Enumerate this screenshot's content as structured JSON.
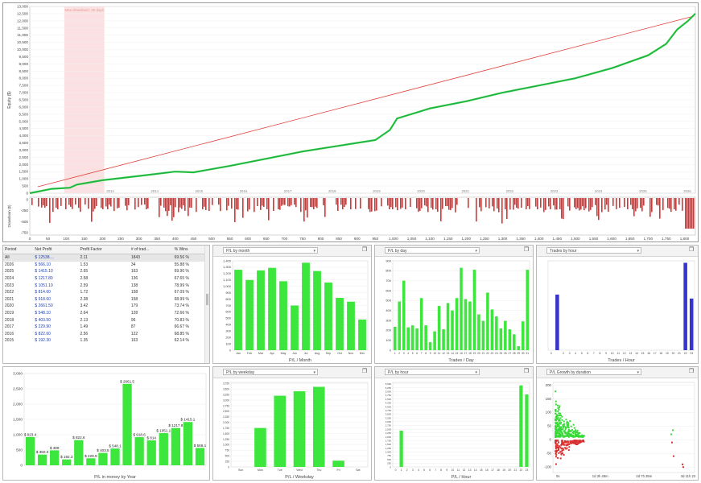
{
  "equity_chart": {
    "y_ticks": [
      "0",
      "500",
      "1,000",
      "1,500",
      "2,000",
      "2,500",
      "3,000",
      "3,500",
      "4,000",
      "4,500",
      "5,000",
      "5,500",
      "6,000",
      "6,500",
      "7,000",
      "7,500",
      "8,000",
      "8,500",
      "9,000",
      "9,500",
      "10,000",
      "10,500",
      "11,000",
      "11,500",
      "12,000",
      "12,500",
      "13,000"
    ],
    "y_label": "Equity ($)",
    "dd_ticks": [
      "0",
      "-250",
      "-500",
      "-750"
    ],
    "dd_label": "Drawdown ($)",
    "x_ticks": [
      "0",
      "50",
      "100",
      "150",
      "200",
      "250",
      "300",
      "350",
      "400",
      "450",
      "500",
      "550",
      "600",
      "650",
      "700",
      "750",
      "800",
      "850",
      "900",
      "950",
      "1,000",
      "1,050",
      "1,100",
      "1,150",
      "1,200",
      "1,250",
      "1,300",
      "1,350",
      "1,400",
      "1,450",
      "1,500",
      "1,550",
      "1,600",
      "1,650",
      "1,700",
      "1,750",
      "1,800"
    ],
    "year_labels": [
      "2013",
      "2014",
      "2015",
      "2016",
      "2017",
      "2018",
      "2019",
      "2020",
      "2021",
      "2022",
      "2023",
      "2024",
      "2025",
      "2026"
    ],
    "highlight_label": "Max drawdown: 30 days",
    "colors": {
      "equity": "#22cc33",
      "trend": "#e0413a",
      "drawdown": "#e03030",
      "highlight": "#fbdede"
    }
  },
  "stats_table": {
    "headers": [
      "Period",
      "Net Profit",
      "Profit Factor",
      "# of trad...",
      "% Wins"
    ],
    "rows": [
      [
        "All",
        "$ 12538....",
        "2.11",
        "1843",
        "69.56 %"
      ],
      [
        "2026",
        "$ 566.10",
        "1.53",
        "34",
        "55.88 %"
      ],
      [
        "2025",
        "$ 1415.10",
        "2.65",
        "163",
        "69.90 %"
      ],
      [
        "2024",
        "$ 1217.80",
        "2.58",
        "136",
        "67.65 %"
      ],
      [
        "2023",
        "$ 1051.10",
        "2.59",
        "138",
        "78.99 %"
      ],
      [
        "2022",
        "$ 814.60",
        "1.72",
        "158",
        "67.09 %"
      ],
      [
        "2021",
        "$ 918.60",
        "2.38",
        "158",
        "68.99 %"
      ],
      [
        "2020",
        "$ 2661.50",
        "3.42",
        "179",
        "73.74 %"
      ],
      [
        "2019",
        "$ 548.10",
        "2.64",
        "128",
        "72.66 %"
      ],
      [
        "2018",
        "$ 403.50",
        "2.13",
        "96",
        "70.83 %"
      ],
      [
        "2017",
        "$ 229.90",
        "1.49",
        "87",
        "66.67 %"
      ],
      [
        "2016",
        "$ 822.60",
        "2.56",
        "122",
        "68.85 %"
      ],
      [
        "2015",
        "$ 192.30",
        "1.35",
        "163",
        "62.14 %"
      ]
    ]
  },
  "panels": {
    "month": {
      "select": "P/L by month"
    },
    "day": {
      "select": "P/L by day"
    },
    "trades_hour": {
      "select": "Trades by hour"
    },
    "weekday": {
      "select": "P/L by weekday"
    },
    "hour": {
      "select": "P/L by hour"
    },
    "duration": {
      "select": "P/L Growth by duration"
    }
  },
  "chart_data": [
    {
      "type": "bar",
      "id": "pl_month",
      "xlabel": "P/L / Month",
      "categories": [
        "Jan",
        "Feb",
        "Mar",
        "Apr",
        "May",
        "Jun",
        "Jul",
        "Aug",
        "Sep",
        "Oct",
        "Nov",
        "Dec"
      ],
      "values": [
        1260,
        1100,
        1250,
        1290,
        1080,
        700,
        1370,
        1240,
        1060,
        820,
        760,
        480
      ],
      "ylim": [
        0,
        1400
      ],
      "y_ticks": [
        "0",
        "100",
        "200",
        "300",
        "400",
        "500",
        "600",
        "700",
        "800",
        "900",
        "1,000",
        "1,100",
        "1,200",
        "1,300",
        "1,400"
      ],
      "color": "#3ce63c"
    },
    {
      "type": "bar",
      "id": "pl_day",
      "xlabel": "Trades / Day",
      "categories": [
        "1",
        "2",
        "3",
        "4",
        "5",
        "6",
        "7",
        "8",
        "9",
        "10",
        "11",
        "12",
        "13",
        "14",
        "15",
        "16",
        "17",
        "18",
        "19",
        "20",
        "21",
        "22",
        "23",
        "24",
        "25",
        "26",
        "27",
        "28",
        "29",
        "30",
        "31"
      ],
      "values": [
        235,
        490,
        700,
        230,
        250,
        220,
        525,
        250,
        80,
        190,
        445,
        210,
        475,
        400,
        525,
        830,
        515,
        490,
        810,
        360,
        295,
        580,
        410,
        340,
        220,
        295,
        210,
        160,
        40,
        290,
        810
      ],
      "ylim": [
        0,
        900
      ],
      "y_ticks": [
        "0",
        "100",
        "200",
        "300",
        "400",
        "500",
        "600",
        "700",
        "800",
        "900"
      ],
      "color": "#3ce63c"
    },
    {
      "type": "bar",
      "id": "trades_hour",
      "xlabel": "Trades / Hour",
      "categories": [
        "0",
        "1",
        "2",
        "3",
        "4",
        "5",
        "6",
        "7",
        "8",
        "9",
        "10",
        "11",
        "12",
        "13",
        "14",
        "15",
        "16",
        "17",
        "18",
        "19",
        "20",
        "21",
        "22",
        "23"
      ],
      "tick_labels": [
        "0",
        "",
        "2",
        "3",
        "4",
        "5",
        "6",
        "7",
        "8",
        "9",
        "10",
        "11",
        "12",
        "13",
        "14",
        "15",
        "16",
        "17",
        "18",
        "19",
        "20",
        "21",
        "22",
        "23"
      ],
      "values": [
        0,
        560,
        0,
        0,
        0,
        0,
        0,
        0,
        0,
        0,
        0,
        0,
        0,
        0,
        0,
        0,
        0,
        0,
        0,
        0,
        0,
        0,
        880,
        520
      ],
      "ylim": [
        0,
        900
      ],
      "color": "#3535cc"
    },
    {
      "type": "bar",
      "id": "pl_year",
      "xlabel": "P/L in money by Year",
      "categories": [
        "2012",
        "2013",
        "2014",
        "2015",
        "2016",
        "2017",
        "2018",
        "2019",
        "2020",
        "2021",
        "2022",
        "2023",
        "2024",
        "2025",
        "2026"
      ],
      "values": [
        923.4,
        350,
        489,
        192.3,
        822.6,
        229.9,
        403.5,
        548.1,
        2661.5,
        918.6,
        814,
        1051.1,
        1217.8,
        1415.1,
        566.1
      ],
      "labels": [
        "$ 923.4",
        "$ 350.0",
        "$ 489",
        "$ 192.3",
        "$ 822.6",
        "$ 229.9",
        "$ 403.5",
        "$ 548.1",
        "$ 2661.5",
        "$ 918.6",
        "$ 814",
        "$ 1051.1",
        "$ 1217.8",
        "$ 1415.1",
        "$ 566.1"
      ],
      "ylim": [
        0,
        3000
      ],
      "y_ticks": [
        "0",
        "500",
        "1,000",
        "1,500",
        "2,000",
        "2,500",
        "3,000"
      ],
      "color": "#3ce63c"
    },
    {
      "type": "bar",
      "id": "pl_weekday",
      "xlabel": "P/L / Weekday",
      "categories": [
        "Sun",
        "Mon",
        "Tue",
        "Wed",
        "Thu",
        "Fri",
        "Sat"
      ],
      "values": [
        0,
        1750,
        3200,
        3400,
        3600,
        280,
        0
      ],
      "ylim": [
        0,
        3800
      ],
      "y_ticks": [
        "0",
        "250",
        "500",
        "750",
        "1,000",
        "1,250",
        "1,500",
        "1,750",
        "2,000",
        "2,250",
        "2,500",
        "2,750",
        "3,000",
        "3,250",
        "3,500",
        "3,750"
      ],
      "color": "#3ce63c"
    },
    {
      "type": "bar",
      "id": "pl_hour",
      "xlabel": "P/L / Hour",
      "categories": [
        "0",
        "1",
        "2",
        "3",
        "4",
        "5",
        "6",
        "7",
        "8",
        "9",
        "10",
        "11",
        "12",
        "13",
        "14",
        "15",
        "16",
        "17",
        "18",
        "19",
        "20",
        "21",
        "22",
        "23"
      ],
      "values": [
        0,
        2400,
        0,
        0,
        0,
        0,
        0,
        0,
        0,
        0,
        0,
        0,
        0,
        0,
        0,
        0,
        0,
        0,
        0,
        0,
        0,
        0,
        5400,
        4800
      ],
      "ylim": [
        0,
        5600
      ],
      "y_ticks": [
        "0",
        "250",
        "500",
        "750",
        "1,000",
        "1,250",
        "1,500",
        "1,750",
        "2,000",
        "2,250",
        "2,500",
        "2,750",
        "3,000",
        "3,250",
        "3,500",
        "3,750",
        "4,000",
        "4,250",
        "4,500",
        "4,750",
        "5,000",
        "5,250",
        "5,500"
      ],
      "color": "#3ce63c"
    },
    {
      "type": "scatter",
      "id": "pl_duration",
      "y_ticks": [
        "200",
        "150",
        "100",
        "50",
        "0",
        "-50",
        "-100"
      ],
      "x_ticks": [
        "0s",
        "1d 3h 48m",
        "2d 7h 35m",
        "3d 11h 23"
      ],
      "ylim": [
        -120,
        210
      ],
      "colors": {
        "win": "#39d939",
        "loss": "#d83030"
      }
    }
  ]
}
